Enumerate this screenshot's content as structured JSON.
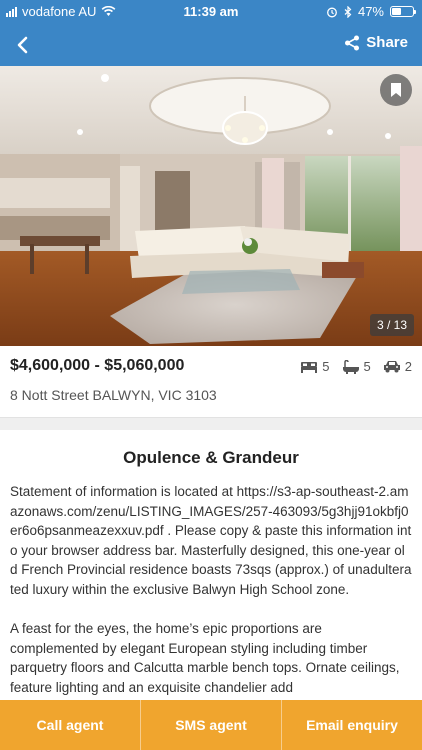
{
  "status_bar": {
    "carrier": "vodafone AU",
    "time": "11:39 am",
    "battery": "47%",
    "battery_level": 0.47
  },
  "nav": {
    "back_icon": "chevron-left-icon",
    "share_label": "Share",
    "share_icon": "share-icon"
  },
  "hero": {
    "photo_counter": "3 / 13",
    "bookmark_icon": "bookmark-icon"
  },
  "listing": {
    "price": "$4,600,000 - $5,060,000",
    "address": "8 Nott Street BALWYN, VIC 3103",
    "bedrooms": "5",
    "bathrooms": "5",
    "parking": "2"
  },
  "description": {
    "headline": "Opulence & Grandeur",
    "paragraph_1": "Statement of information is located at https://s3-ap-southeast-2.amazonaws.com/zenu/LISTING_IMAGES/257-463093/5g3hjj91okbfj0er6o6psanmeazexxuv.pdf . Please copy & paste this information into your browser address bar. Masterfully designed, this one-year old French Provincial residence boasts 73sqs (approx.) of unadulterated luxury within the exclusive Balwyn High School zone.",
    "paragraph_2": "A feast for the eyes, the home’s epic proportions are complemented by elegant European styling including timber parquetry floors and Calcutta marble bench tops. Ornate ceilings, feature lighting and an exquisite chandelier add"
  },
  "actions": {
    "call": "Call agent",
    "sms": "SMS agent",
    "email": "Email enquiry"
  },
  "colors": {
    "header": "#3b86c6",
    "action_bar": "#f0a52e"
  }
}
